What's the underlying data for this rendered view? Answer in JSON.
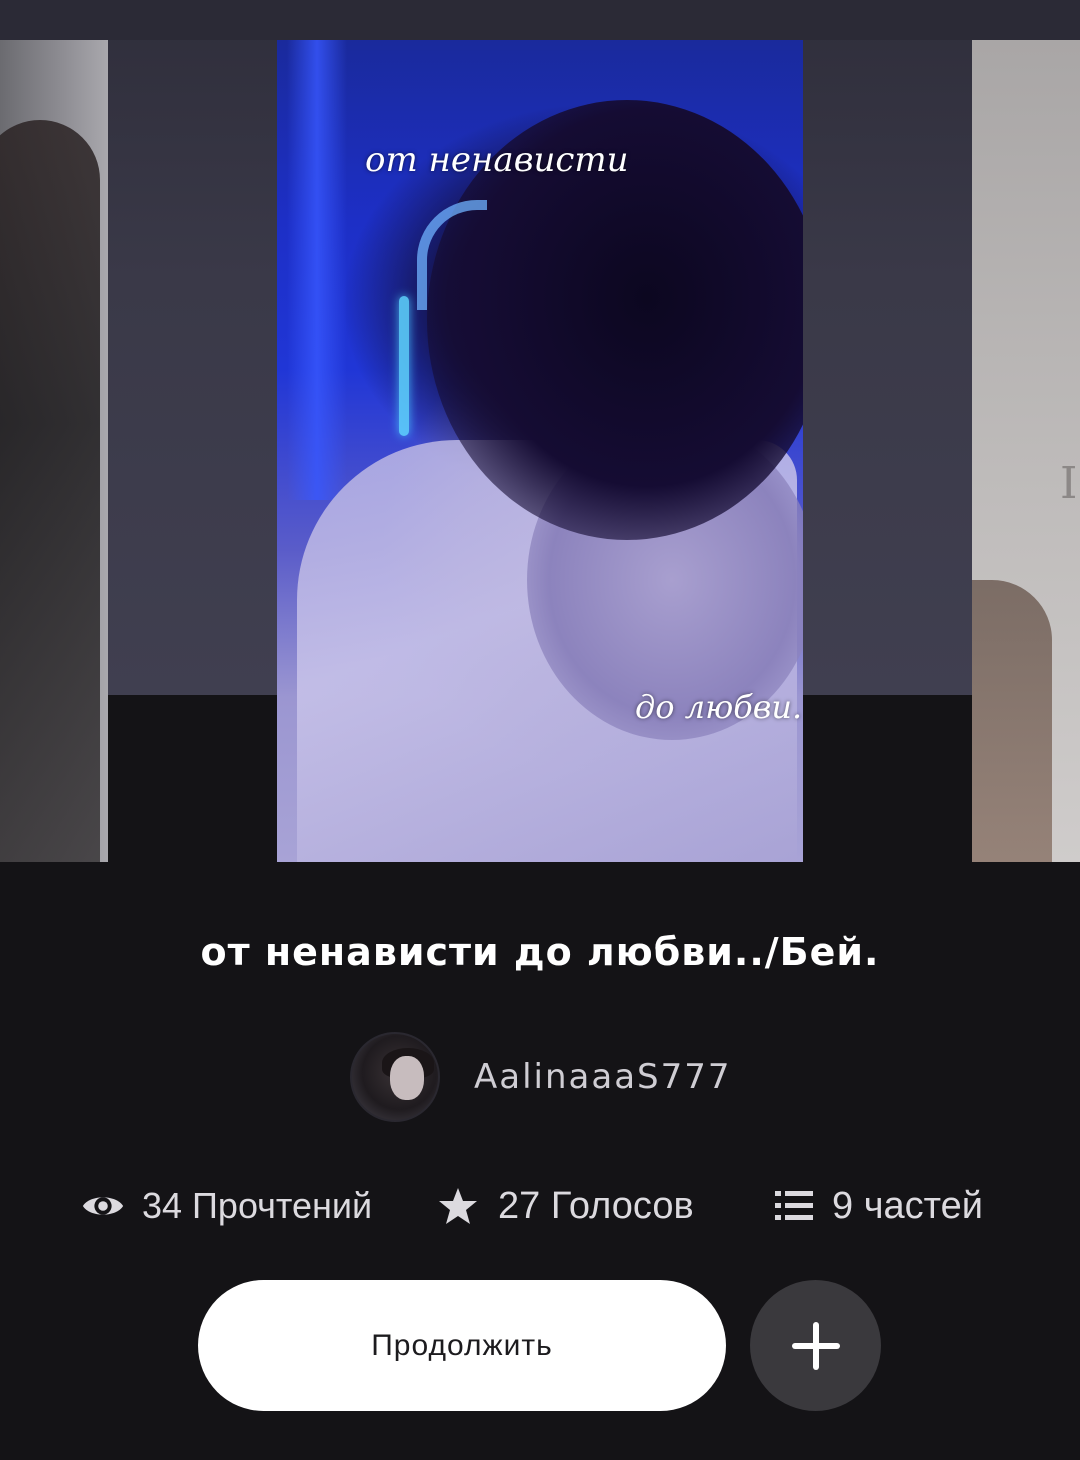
{
  "cover": {
    "text_top": "от ненависти",
    "text_bottom": "до любви."
  },
  "side_cover_right": {
    "letter": "I"
  },
  "story": {
    "title": "от ненависти до любви../Бей."
  },
  "author": {
    "name": "AalinaaaS777"
  },
  "stats": {
    "reads": "34 Прочтений",
    "votes": "27 Голосов",
    "parts": "9 частей"
  },
  "actions": {
    "continue_label": "Продолжить",
    "add_icon": "plus-icon"
  },
  "icons": {
    "reads": "eye-icon",
    "votes": "star-icon",
    "parts": "list-icon"
  },
  "colors": {
    "background": "#141316",
    "continue_button": "#ffffff",
    "add_button": "#3a393d",
    "text": "#ffffff"
  }
}
